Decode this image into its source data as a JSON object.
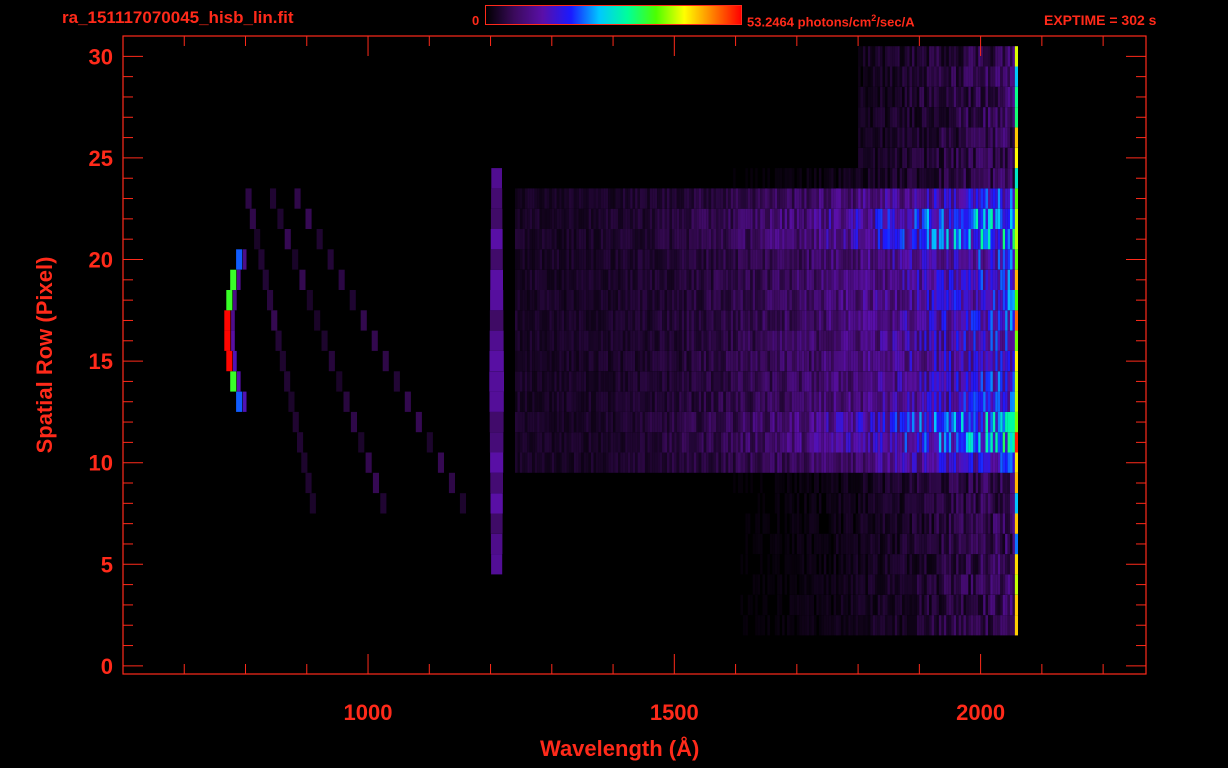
{
  "header": {
    "title": "ra_151117070045_hisb_lin.fit",
    "colorbar_min": "0",
    "colorbar_max_value": "53.2464",
    "colorbar_unit_pre": "photons/cm",
    "colorbar_unit_sup": "2",
    "colorbar_unit_post": "/sec/A",
    "exptime": "EXPTIME = 302 s"
  },
  "colors": {
    "axis": "#ff2a1a",
    "background": "#000000",
    "colormap": [
      "#000000",
      "#3b0a5c",
      "#5a0fa8",
      "#1a1aff",
      "#00c8ff",
      "#00ff9a",
      "#4cff00",
      "#ffff00",
      "#ff8000",
      "#ff0000"
    ]
  },
  "chart_data": {
    "type": "heatmap",
    "xlabel": "Wavelength (Å)",
    "ylabel": "Spatial Row (Pixel)",
    "xlim": [
      600,
      2270
    ],
    "ylim": [
      -0.4,
      31
    ],
    "x_ticks": [
      1000,
      1500,
      2000
    ],
    "x_minor_step": 100,
    "y_ticks": [
      0,
      5,
      10,
      15,
      20,
      25,
      30
    ],
    "y_minor_step": 1,
    "grid": false,
    "colorscale_range": [
      0,
      53.2464
    ],
    "colorscale_unit": "photons/cm^2/sec/A",
    "features": [
      {
        "label": "arc",
        "x_center": 770,
        "y_range": [
          13,
          20
        ],
        "peak": 53,
        "note": "bright curved emission"
      },
      {
        "label": "line_1216",
        "x_center": 1210,
        "y_range": [
          5,
          24
        ],
        "peak": 12
      },
      {
        "label": "continuum",
        "x_range": [
          1300,
          2060
        ],
        "y_range": [
          2,
          30
        ],
        "peak": 25
      },
      {
        "label": "edge",
        "x_center": 2060,
        "y_range": [
          2,
          30
        ],
        "peak": 53
      }
    ]
  }
}
